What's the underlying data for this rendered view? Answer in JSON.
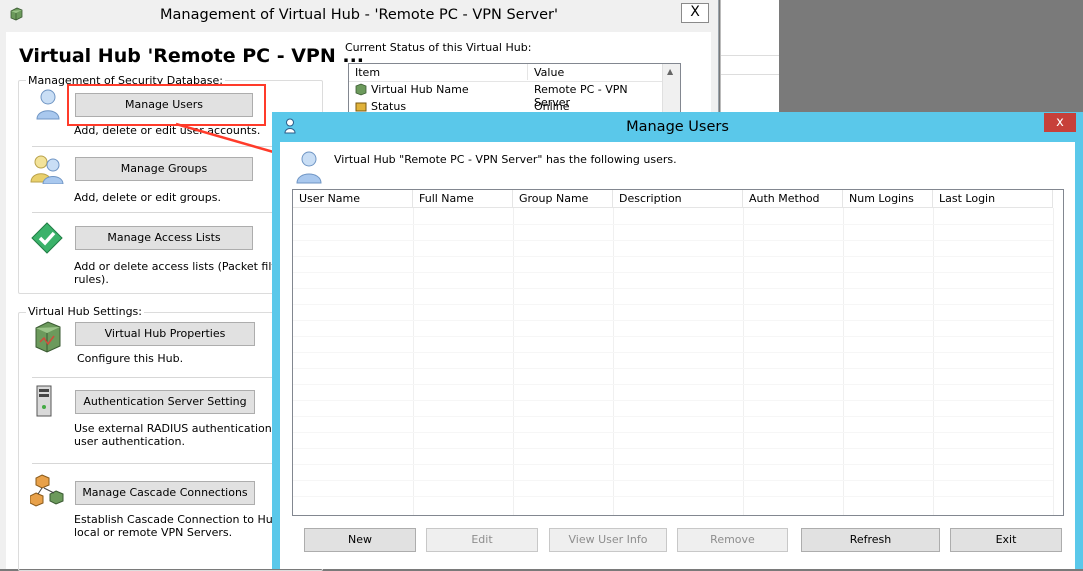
{
  "main_window": {
    "title": "Management of Virtual Hub - 'Remote PC - VPN Server'",
    "close_label": "X",
    "heading": "Virtual Hub 'Remote PC - VPN ...",
    "security_group_label": "Management of Security Database:",
    "manage_users_label": "Manage Users",
    "manage_users_desc": "Add, delete or edit user accounts.",
    "manage_groups_label": "Manage Groups",
    "manage_groups_desc": "Add, delete or edit groups.",
    "manage_access_label": "Manage Access Lists",
    "manage_access_desc_1": "Add or delete access lists (Packet filtering",
    "manage_access_desc_2": "rules).",
    "settings_group_label": "Virtual Hub Settings:",
    "hub_props_label": "Virtual Hub Properties",
    "hub_props_desc": "Configure this Hub.",
    "auth_server_label": "Authentication Server Setting",
    "auth_server_desc_1": "Use external RADIUS authentication server",
    "auth_server_desc_2": "user authentication.",
    "cascade_label": "Manage Cascade Connections",
    "cascade_desc_1": "Establish Cascade Connection to Hubs on",
    "cascade_desc_2": "local or remote VPN Servers.",
    "status_group_label": "Current Status of this Virtual Hub:",
    "status_columns": [
      "Item",
      "Value"
    ],
    "status_rows": [
      {
        "item": "Virtual Hub Name",
        "value": "Remote PC - VPN Server"
      },
      {
        "item": "Status",
        "value": "Online"
      }
    ]
  },
  "dialog": {
    "title": "Manage Users",
    "close_label": "x",
    "intro": "Virtual Hub \"Remote PC - VPN Server\" has the following users.",
    "columns": [
      "User Name",
      "Full Name",
      "Group Name",
      "Description",
      "Auth Method",
      "Num Logins",
      "Last Login"
    ],
    "buttons": {
      "new": "New",
      "edit": "Edit",
      "view_info": "View User Info",
      "remove": "Remove",
      "refresh": "Refresh",
      "exit": "Exit"
    }
  },
  "colors": {
    "accent": "#5ac8ea",
    "highlight": "#ff3b2a",
    "close_red": "#c7403a"
  }
}
